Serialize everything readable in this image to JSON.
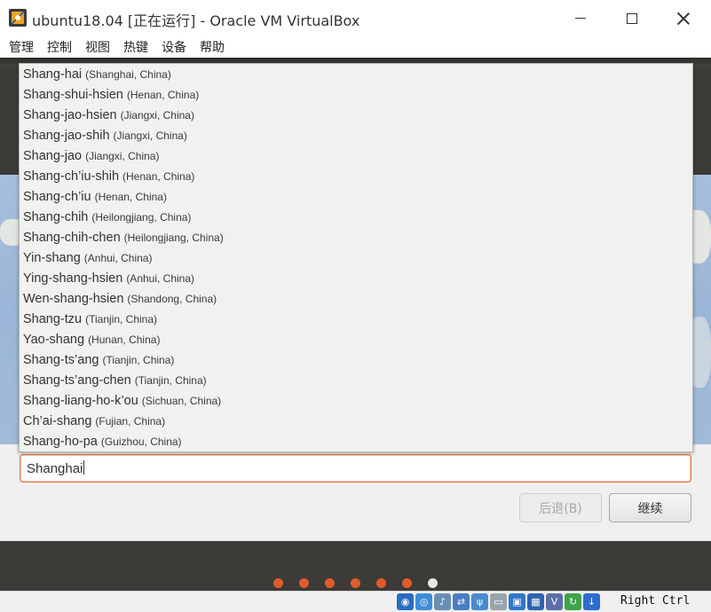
{
  "window": {
    "title": "ubuntu18.04 [正在运行] - Oracle VM VirtualBox"
  },
  "menu": [
    "管理",
    "控制",
    "视图",
    "热键",
    "设备",
    "帮助"
  ],
  "timezone": {
    "input_value": "Shanghai",
    "suggestions": [
      {
        "name": "Shang-hai",
        "region": "(Shanghai, China)"
      },
      {
        "name": "Shang-shui-hsien",
        "region": "(Henan, China)"
      },
      {
        "name": "Shang-jao-hsien",
        "region": "(Jiangxi, China)"
      },
      {
        "name": "Shang-jao-shih",
        "region": "(Jiangxi, China)"
      },
      {
        "name": "Shang-jao",
        "region": "(Jiangxi, China)"
      },
      {
        "name": "Shang-ch’iu-shih",
        "region": "(Henan, China)"
      },
      {
        "name": "Shang-ch’iu",
        "region": "(Henan, China)"
      },
      {
        "name": "Shang-chih",
        "region": "(Heilongjiang, China)"
      },
      {
        "name": "Shang-chih-chen",
        "region": "(Heilongjiang, China)"
      },
      {
        "name": "Yin-shang",
        "region": "(Anhui, China)"
      },
      {
        "name": "Ying-shang-hsien",
        "region": "(Anhui, China)"
      },
      {
        "name": "Wen-shang-hsien",
        "region": "(Shandong, China)"
      },
      {
        "name": "Shang-tzu",
        "region": "(Tianjin, China)"
      },
      {
        "name": "Yao-shang",
        "region": "(Hunan, China)"
      },
      {
        "name": "Shang-ts’ang",
        "region": "(Tianjin, China)"
      },
      {
        "name": "Shang-ts’ang-chen",
        "region": "(Tianjin, China)"
      },
      {
        "name": "Shang-liang-ho-k’ou",
        "region": "(Sichuan, China)"
      },
      {
        "name": "Ch’ai-shang",
        "region": "(Fujian, China)"
      },
      {
        "name": "Shang-ho-pa",
        "region": "(Guizhou, China)"
      }
    ]
  },
  "buttons": {
    "back": "后退(B)",
    "continue": "继续"
  },
  "progress": {
    "total_steps": 7,
    "current_step": 7
  },
  "statusbar": {
    "icons": [
      "hard-disk-icon",
      "optical-drive-icon",
      "audio-icon",
      "network-icon",
      "usb-icon",
      "shared-folders-icon",
      "display-icon",
      "video-capture-icon",
      "virtualization-icon",
      "mouse-integration-icon",
      "keyboard-capture-icon"
    ],
    "host_key": "Right Ctrl"
  },
  "colors": {
    "accent": "#e05b2c",
    "guest_background": "#3c3b37",
    "input_border": "#e07a4a"
  }
}
